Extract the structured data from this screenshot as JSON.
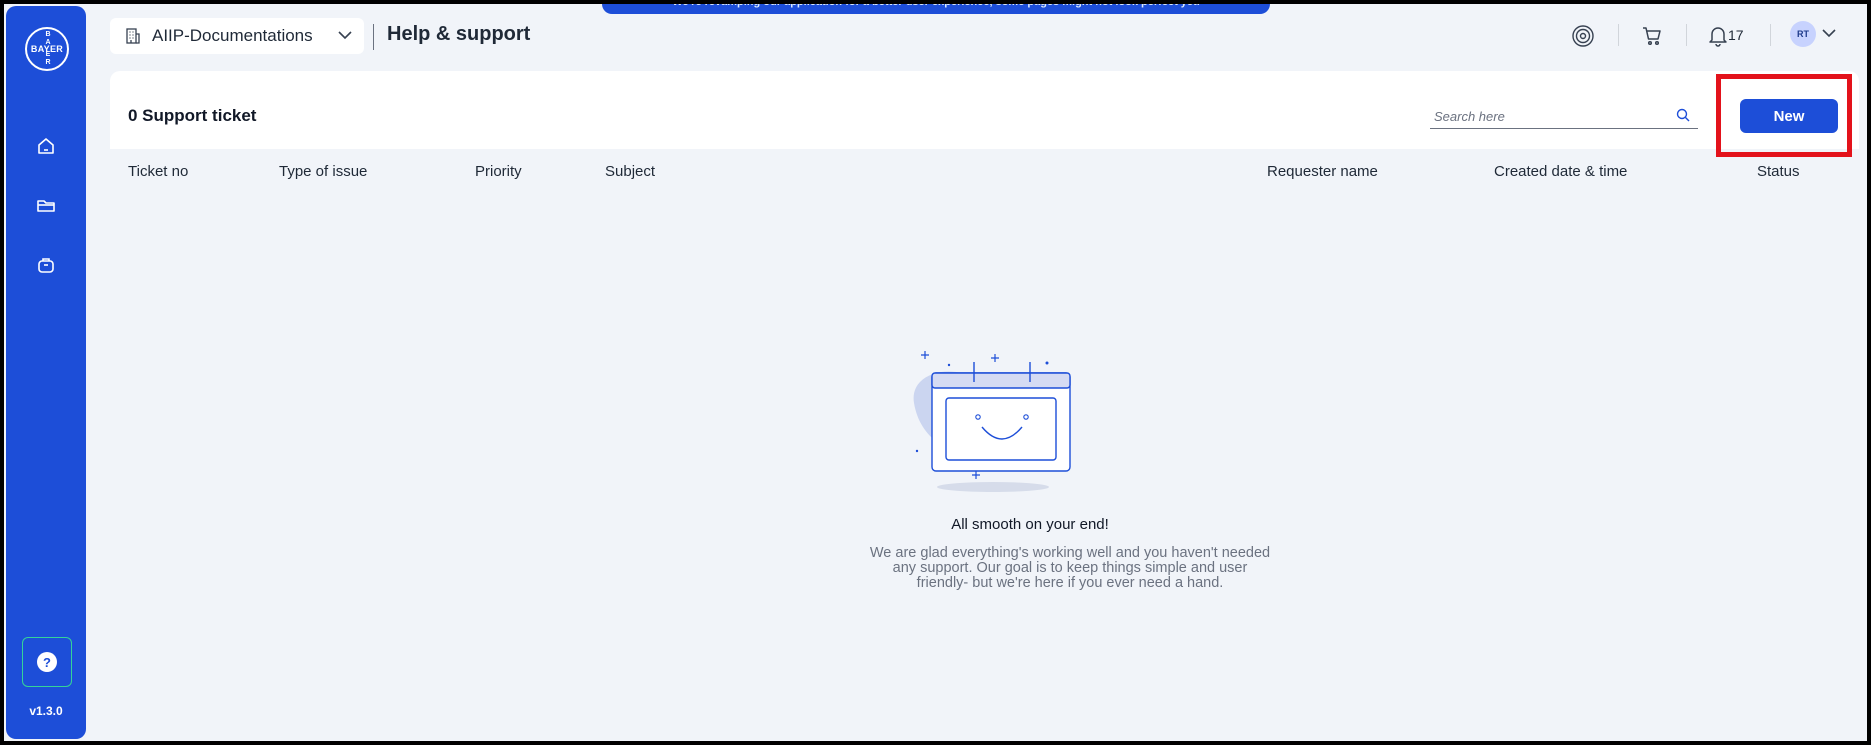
{
  "banner": {
    "text": "We're revamping our application for a better user experience, some pages might not look perfect yet."
  },
  "sidebar": {
    "logo": {
      "main": "BAYER",
      "vertical_top": "B A",
      "vertical_bottom": "E R"
    },
    "items": [
      {
        "name": "home",
        "icon": "home-icon"
      },
      {
        "name": "folders",
        "icon": "folder-icon"
      },
      {
        "name": "bag",
        "icon": "bag-icon"
      }
    ],
    "help_label": "?",
    "version": "v1.3.0"
  },
  "header": {
    "workspace": "AIIP-Documentations",
    "title": "Help & support",
    "notifications_count": "17",
    "avatar_initials": "RT"
  },
  "tickets": {
    "count_label": "0 Support ticket",
    "search_placeholder": "Search here",
    "new_label": "New",
    "columns": [
      "Ticket no",
      "Type of issue",
      "Priority",
      "Subject",
      "Requester name",
      "Created date & time",
      "Status"
    ]
  },
  "empty_state": {
    "title": "All smooth on your end!",
    "description_lines": [
      "We are glad everything's working well and you haven't needed",
      "any support. Our goal is to keep things simple and user",
      "friendly- but we're here if you ever need a hand."
    ]
  },
  "colors": {
    "brand": "#1d4ed8",
    "highlight": "#e3121b",
    "background": "#f1f4f9"
  }
}
